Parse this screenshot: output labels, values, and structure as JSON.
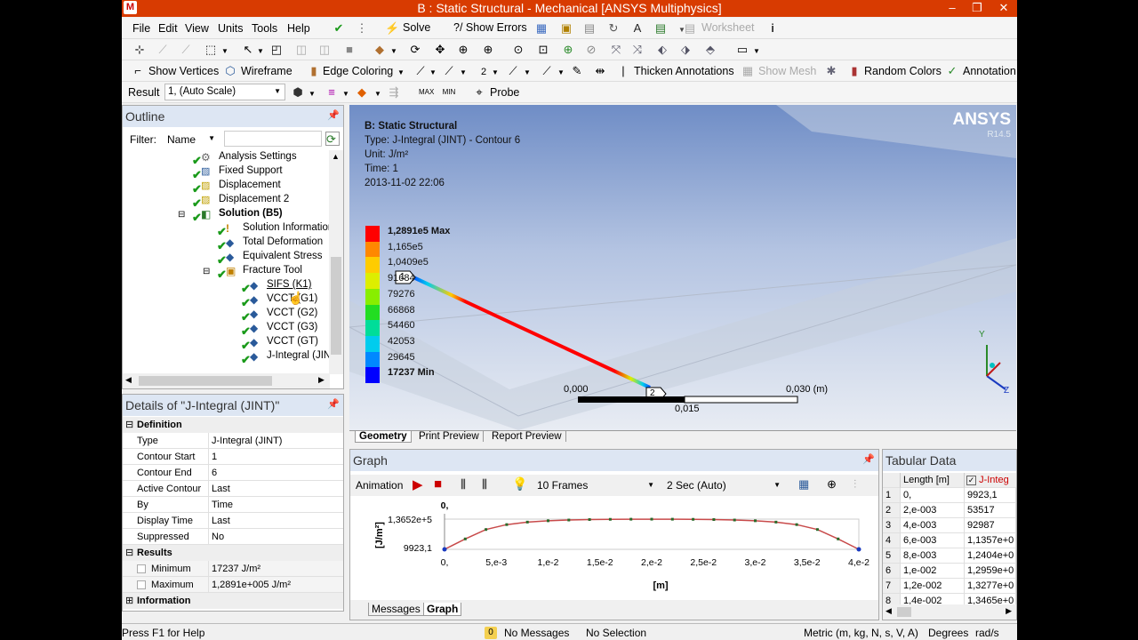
{
  "window": {
    "title": "B : Static Structural - Mechanical [ANSYS Multiphysics]",
    "app_icon": "M"
  },
  "menu": [
    "File",
    "Edit",
    "View",
    "Units",
    "Tools",
    "Help"
  ],
  "toolbar1": {
    "solve": "Solve",
    "show_errors": "?/ Show Errors",
    "worksheet": "Worksheet"
  },
  "toolbar3": {
    "show_vertices": "Show Vertices",
    "wireframe": "Wireframe",
    "edge_coloring": "Edge Coloring",
    "edge_num": "2",
    "thicken_annotations": "Thicken Annotations",
    "show_mesh": "Show Mesh",
    "random_colors": "Random Colors",
    "annotation": "Annotation"
  },
  "toolbar4": {
    "result_label": "Result",
    "result_value": "1, (Auto Scale)",
    "probe": "Probe"
  },
  "outline": {
    "title": "Outline",
    "filter_label": "Filter:",
    "filter_value": "Name",
    "items": [
      "Analysis Settings",
      "Fixed Support",
      "Displacement",
      "Displacement 2",
      "Solution (B5)",
      "Solution Information",
      "Total Deformation",
      "Equivalent Stress",
      "Fracture Tool",
      "SIFS (K1)",
      "VCCT (G1)",
      "VCCT (G2)",
      "VCCT (G3)",
      "VCCT (GT)",
      "J-Integral (JIN"
    ]
  },
  "details": {
    "title": "Details of \"J-Integral (JINT)\"",
    "sections": {
      "definition": "Definition",
      "results": "Results",
      "information": "Information"
    },
    "rows": [
      {
        "k": "Type",
        "v": "J-Integral (JINT)"
      },
      {
        "k": "Contour Start",
        "v": "1"
      },
      {
        "k": "Contour End",
        "v": "6"
      },
      {
        "k": "Active Contour",
        "v": "Last"
      },
      {
        "k": "By",
        "v": "Time"
      },
      {
        "k": "Display Time",
        "v": "Last"
      },
      {
        "k": "Suppressed",
        "v": "No"
      }
    ],
    "results": [
      {
        "k": "Minimum",
        "v": "17237 J/m²"
      },
      {
        "k": "Maximum",
        "v": "1,2891e+005 J/m²"
      }
    ]
  },
  "viewport": {
    "header": "B: Static Structural",
    "type": "J-Integral (JINT)",
    "type_label": "Type: J-Integral (JINT) - Contour 6",
    "unit": "Unit: J/m²",
    "time": "Time: 1",
    "date": "2013-11-02 22:06",
    "logo": "ANSYS",
    "version": "R14.5",
    "legend": [
      "1,2891e5 Max",
      "1,165e5",
      "1,0409e5",
      "91684",
      "79276",
      "66868",
      "54460",
      "42053",
      "29645",
      "17237 Min"
    ],
    "legend_colors": [
      "#ff0000",
      "#ff8800",
      "#ffcc00",
      "#ddee00",
      "#88ee00",
      "#22dd22",
      "#00dd99",
      "#00ccee",
      "#0088ff",
      "#0000ff"
    ],
    "point_labels": [
      "1",
      "2"
    ],
    "scale": {
      "left": "0,000",
      "mid": "0,015",
      "right": "0,030 (m)"
    },
    "triad": {
      "y": "Y",
      "z": "Z"
    },
    "tabs": [
      "Geometry",
      "Print Preview",
      "Report Preview"
    ]
  },
  "graph": {
    "title": "Graph",
    "animation": "Animation",
    "frames": "10 Frames",
    "speed": "2 Sec (Auto)",
    "tabs": [
      "Messages",
      "Graph"
    ]
  },
  "chart_data": {
    "type": "line",
    "title": "",
    "xlabel": "[m]",
    "ylabel": "[J/m²]",
    "x_ticks": [
      "0,",
      "5,e-3",
      "1,e-2",
      "1,5e-2",
      "2,e-2",
      "2,5e-2",
      "3,e-2",
      "3,5e-2",
      "4,e-2"
    ],
    "y_ticks": [
      "0,",
      "1,3652e+5",
      "9923,1"
    ],
    "xlim": [
      0,
      0.04
    ],
    "ylim": [
      9923.1,
      136520
    ],
    "x": [
      0,
      0.002,
      0.004,
      0.006,
      0.008,
      0.01,
      0.012,
      0.014,
      0.016,
      0.018,
      0.02,
      0.022,
      0.024,
      0.026,
      0.028,
      0.03,
      0.032,
      0.034,
      0.036,
      0.038,
      0.04
    ],
    "values": [
      9923.1,
      53517,
      92987,
      113570,
      124040,
      129590,
      132770,
      134650,
      135600,
      136100,
      136300,
      136100,
      135600,
      134650,
      132770,
      129590,
      124040,
      113570,
      92987,
      53517,
      9923.1
    ]
  },
  "tabular": {
    "title": "Tabular Data",
    "col1": "Length [m]",
    "col2": "J-Integ",
    "rows": [
      {
        "n": "1",
        "len": "0,",
        "val": "9923,1"
      },
      {
        "n": "2",
        "len": "2,e-003",
        "val": "53517"
      },
      {
        "n": "3",
        "len": "4,e-003",
        "val": "92987"
      },
      {
        "n": "4",
        "len": "6,e-003",
        "val": "1,1357e+0"
      },
      {
        "n": "5",
        "len": "8,e-003",
        "val": "1,2404e+0"
      },
      {
        "n": "6",
        "len": "1,e-002",
        "val": "1,2959e+0"
      },
      {
        "n": "7",
        "len": "1,2e-002",
        "val": "1,3277e+0"
      },
      {
        "n": "8",
        "len": "1,4e-002",
        "val": "1,3465e+0"
      }
    ]
  },
  "status": {
    "help": "Press F1 for Help",
    "messages_count": "0",
    "messages": "No Messages",
    "selection": "No Selection",
    "units": "Metric (m, kg, N, s, V, A)",
    "degrees": "Degrees",
    "rads": "rad/s"
  }
}
